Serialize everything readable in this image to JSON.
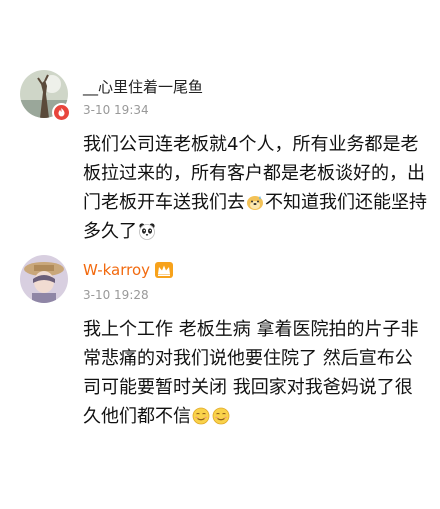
{
  "comments": [
    {
      "username": "__心里住着一尾鱼",
      "time": "3-10 19:34",
      "text_part1": "我们公司连老板就4个人，所有业务都是老板拉过来的，所有客户都是老板谈好的，出门老板开车送我们去",
      "text_part2": "不知道我们还能坚持多久了",
      "emojis": [
        "doge-sweat-emoji",
        "panda-emoji"
      ]
    },
    {
      "username": "W-karroy",
      "time": "3-10 19:28",
      "text_part1": "我上个工作 老板生病 拿着医院拍的片子非常悲痛的对我们说他要住院了 然后宣布公司可能要暂时关闭 我回家对我爸妈说了很久他们都不信",
      "emojis": [
        "awkward-smile-emoji",
        "awkward-smile-emoji"
      ]
    }
  ],
  "colors": {
    "vip_name": "#f26a0f",
    "time_text": "#999999",
    "badge": "#e8453c"
  }
}
